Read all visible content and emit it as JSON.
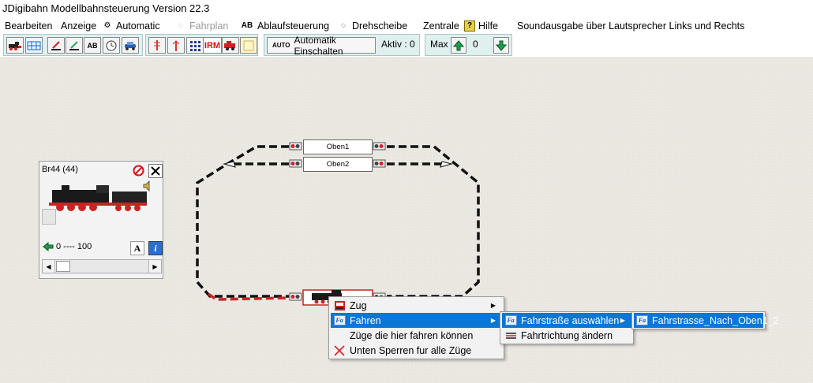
{
  "window": {
    "title": "JDigibahn Modellbahnsteuerung Version 22.3"
  },
  "menu": {
    "bearbeiten": "Bearbeiten",
    "anzeige": "Anzeige",
    "automatic": "Automatic",
    "fahrplan": "Fahrplan",
    "ablaufsteuerung": "Ablaufsteuerung",
    "drehscheibe": "Drehscheibe",
    "zentrale": "Zentrale",
    "hilfe": "Hilfe",
    "sound": "Soundausgabe über Lautsprecher Links und Rechts"
  },
  "toolbar": {
    "irm_label": "IRM",
    "ab_label": "AB",
    "auto_badge": "AUTO",
    "automatik_label": "Automatik Einschalten",
    "aktiv_label": "Aktiv : 0",
    "max_label": "Max",
    "max_value": "0"
  },
  "track": {
    "block_top1": "Oben1",
    "block_top2": "Oben2",
    "track_color": "#111111",
    "active_color": "#cc2222"
  },
  "loco": {
    "name": "Br44 (44)",
    "speed_range": "0 ---- 100",
    "font_button": "A",
    "info_button": "i"
  },
  "context_menu": {
    "items": [
      {
        "label": "Zug",
        "has_submenu": true
      },
      {
        "label": "Fahren",
        "has_submenu": true,
        "highlighted": true
      },
      {
        "label": "Züge die hier fahren können",
        "has_submenu": false
      },
      {
        "label": "Unten Sperren fur alle Züge",
        "has_submenu": false
      }
    ],
    "submenu_fahren": [
      {
        "label": "Fahrstraße auswählen",
        "has_submenu": true,
        "highlighted": true
      },
      {
        "label": "Fahrtrichtung ändern",
        "has_submenu": false
      }
    ],
    "submenu_route": [
      {
        "label": "Fahrstrasse_Nach_Oben1_2",
        "highlighted": true
      }
    ],
    "icon_fa_text": "Fa",
    "highlight_color": "#0a76d6"
  }
}
